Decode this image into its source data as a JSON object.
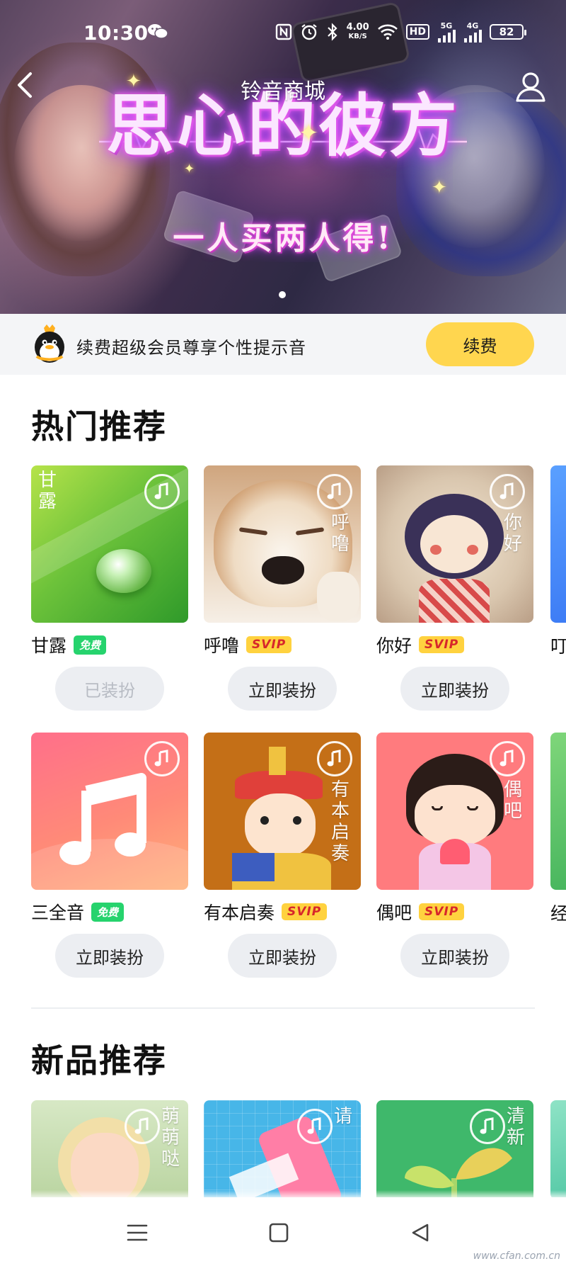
{
  "status_bar": {
    "time": "10:30",
    "net_speed_value": "4.00",
    "net_speed_unit": "KB/S",
    "hd_label": "HD",
    "net_5g": "5G",
    "net_4g": "4G",
    "battery": "82"
  },
  "header": {
    "title": "铃音商城"
  },
  "banner": {
    "headline": "思心的彼方",
    "tagline": "一人买两人得!",
    "page_count": 1,
    "active_page": 1
  },
  "vip": {
    "text": "续费超级会员尊享个性提示音",
    "button": "续费"
  },
  "hot": {
    "title": "热门推荐",
    "items": [
      {
        "name": "甘露",
        "badge": "免费",
        "badge_type": "free",
        "button": "已装扮",
        "applied": true,
        "thumb_text": "甘露",
        "art": "leaf"
      },
      {
        "name": "呼噜",
        "badge": "SVIP",
        "badge_type": "svip",
        "button": "立即装扮",
        "applied": false,
        "thumb_text": "呼噜",
        "art": "dog"
      },
      {
        "name": "你好",
        "badge": "SVIP",
        "badge_type": "svip",
        "button": "立即装扮",
        "applied": false,
        "thumb_text": "你好",
        "art": "doll"
      },
      {
        "name": "三全音",
        "badge": "免费",
        "badge_type": "free",
        "button": "立即装扮",
        "applied": false,
        "thumb_text": "",
        "art": "note"
      },
      {
        "name": "有本启奏",
        "badge": "SVIP",
        "badge_type": "svip",
        "button": "立即装扮",
        "applied": false,
        "thumb_text": "有本启奏",
        "art": "official"
      },
      {
        "name": "偶吧",
        "badge": "SVIP",
        "badge_type": "svip",
        "button": "立即装扮",
        "applied": false,
        "thumb_text": "偶吧",
        "art": "girl"
      }
    ],
    "peek_row1_name": "叮",
    "peek_row2_name": "经"
  },
  "new": {
    "title": "新品推荐",
    "items": [
      {
        "thumb_text": "萌萌哒",
        "art": "child"
      },
      {
        "thumb_text": "请",
        "art": "phone"
      },
      {
        "thumb_text": "清新",
        "art": "sprout"
      }
    ]
  },
  "watermark": "www.cfan.com.cn",
  "colors": {
    "accent_yellow": "#ffd64f",
    "free_green": "#26d36d",
    "svip_yellow": "#ffd23f",
    "svip_red": "#d7272b",
    "button_grey": "#eceef2"
  },
  "icons": [
    "back-icon",
    "user-icon",
    "wechat-icon",
    "nfc-icon",
    "alarm-icon",
    "bluetooth-icon",
    "wifi-icon",
    "signal-icon",
    "qq-penguin-icon",
    "play-note-icon",
    "menu-icon",
    "home-icon",
    "back-triangle-icon"
  ]
}
